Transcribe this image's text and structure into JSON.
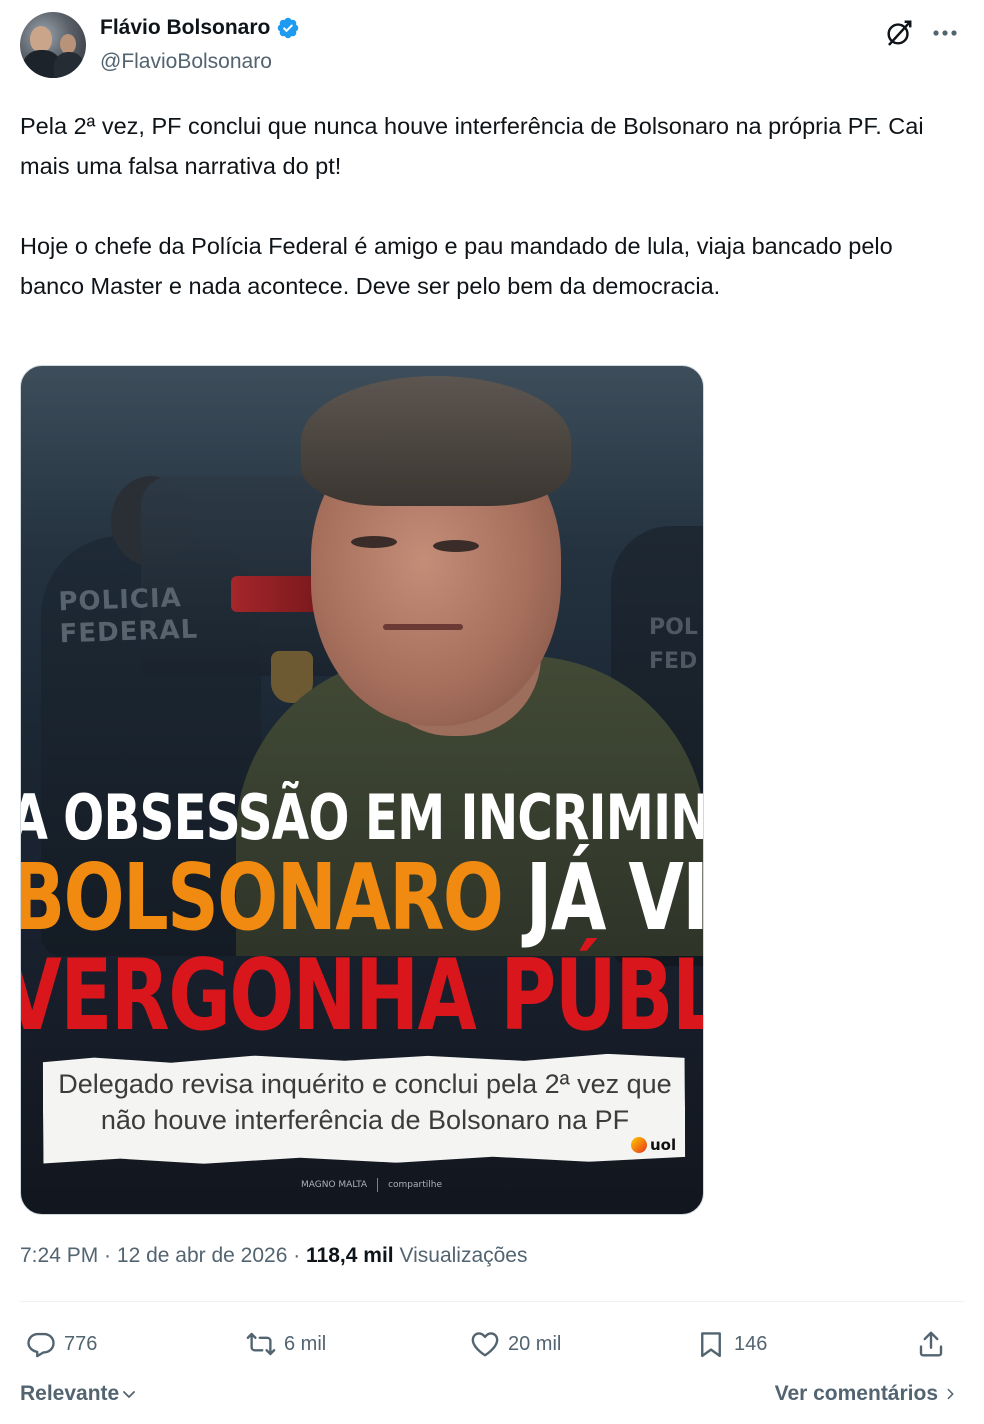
{
  "author": {
    "name": "Flávio Bolsonaro",
    "handle": "@FlavioBolsonaro",
    "verified": true
  },
  "tweet": {
    "text": "Pela 2ª vez, PF conclui que nunca houve interferência de Bolsonaro na própria PF. Cai mais uma falsa narrativa do pt!\n\nHoje o chefe da Polícia Federal é amigo e pau mandado de lula, viaja bancado pelo banco Master e nada acontece. Deve ser pelo bem da democracia."
  },
  "media": {
    "background_text_left": "POLICIA\nFEDERAL",
    "background_text_right": "POL\nFED",
    "headline_line1": "A OBSESSÃO EM INCRIMINAR",
    "headline_line2_orange": "BOLSONARO",
    "headline_line2_white": "JÁ VIROU",
    "headline_line3": "VERGONHA PÚBLICA",
    "caption": "Delegado revisa inquérito e conclui pela 2ª vez que não houve interferência de Bolsonaro na PF",
    "source_logo": "uol",
    "footer_brand": "MAGNO MALTA",
    "footer_share": "compartilhe",
    "colors": {
      "orange": "#f08a10",
      "red": "#d9161c"
    }
  },
  "meta": {
    "time": "7:24 PM",
    "separator": " · ",
    "date": "12 de abr de 2026",
    "views_count": "118,4 mil",
    "views_label": "Visualizações"
  },
  "actions": {
    "replies": "776",
    "reposts": "6 mil",
    "likes": "20 mil",
    "bookmarks": "146"
  },
  "footer": {
    "sort_label": "Relevante",
    "view_comments": "Ver comentários"
  },
  "icons": [
    "verified-badge-icon",
    "grok-icon",
    "more-icon",
    "reply-icon",
    "repost-icon",
    "like-icon",
    "bookmark-icon",
    "share-icon",
    "chevron-down-icon",
    "chevron-right-icon"
  ],
  "colors": {
    "text": "#0f1419",
    "secondary": "#536471",
    "verified": "#1d9bf0"
  }
}
